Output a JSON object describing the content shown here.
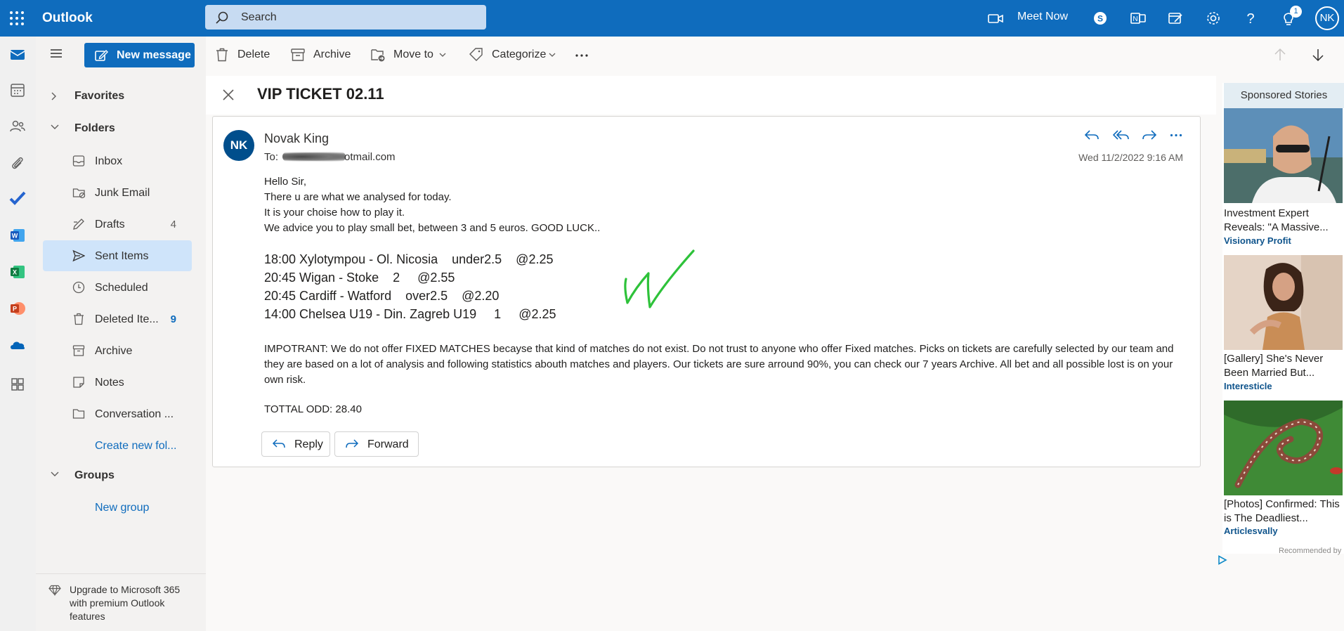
{
  "app": {
    "name": "Outlook"
  },
  "search": {
    "placeholder": "Search"
  },
  "topbar": {
    "meet_now": "Meet Now",
    "notification_count": "1",
    "user_initials": "NK"
  },
  "folderpane": {
    "new_message": "New message",
    "favorites": "Favorites",
    "folders_header": "Folders",
    "folders": [
      {
        "label": "Inbox",
        "count": ""
      },
      {
        "label": "Junk Email",
        "count": ""
      },
      {
        "label": "Drafts",
        "count": "4"
      },
      {
        "label": "Sent Items",
        "count": ""
      },
      {
        "label": "Scheduled",
        "count": ""
      },
      {
        "label": "Deleted Ite...",
        "count": "9"
      },
      {
        "label": "Archive",
        "count": ""
      },
      {
        "label": "Notes",
        "count": ""
      },
      {
        "label": "Conversation ...",
        "count": ""
      }
    ],
    "create_new_folder": "Create new fol...",
    "groups_header": "Groups",
    "new_group": "New group",
    "upgrade": "Upgrade to Microsoft 365 with premium Outlook features"
  },
  "commands": {
    "delete": "Delete",
    "archive": "Archive",
    "move_to": "Move to",
    "categorize": "Categorize"
  },
  "message": {
    "subject": "VIP TICKET 02.11",
    "sender_initials": "NK",
    "sender": "Novak King",
    "to_prefix": "To:",
    "to_suffix": "otmail.com",
    "date": "Wed 11/2/2022 9:16 AM",
    "greeting": "Hello Sir,",
    "line1": "There u are what we analysed for today.",
    "line2": "It is your choise how to play it.",
    "line3": "We advice you to play small bet, between 3 and 5 euros. GOOD LUCK..",
    "picks": [
      "18:00 Xylotympou - Ol. Nicosia    under2.5    @2.25",
      "20:45 Wigan - Stoke    2     @2.55",
      "20:45 Cardiff - Watford    over2.5    @2.20",
      "14:00 Chelsea U19 - Din. Zagreb U19     1     @2.25"
    ],
    "disclaimer": "IMPOTRANT: We do not offer FIXED MATCHES becayse that kind of matches do not exist. Do not trust to anyone who offer Fixed matches. Picks on tickets are carefully selected by our team and they are based on a lot of analysis and following statistics abouth matches and players. Our tickets are sure arround 90%, you can check our 7 years Archive. All bet and all possible lost is on your own risk.",
    "total": "TOTTAL ODD: 28.40",
    "reply": "Reply",
    "forward": "Forward"
  },
  "ads": {
    "header": "Sponsored Stories",
    "items": [
      {
        "title": "Investment Expert Reveals: \"A Massive...",
        "source": "Visionary Profit"
      },
      {
        "title": "[Gallery] She's Never Been Married But...",
        "source": "Interesticle"
      },
      {
        "title": "[Photos] Confirmed: This is The Deadliest...",
        "source": "Articlesvally"
      }
    ],
    "recommended_by": "Recommended by"
  },
  "colors": {
    "brand": "#0f6cbd",
    "selected": "#cfe4fa",
    "check_mark": "#2ec23a"
  }
}
